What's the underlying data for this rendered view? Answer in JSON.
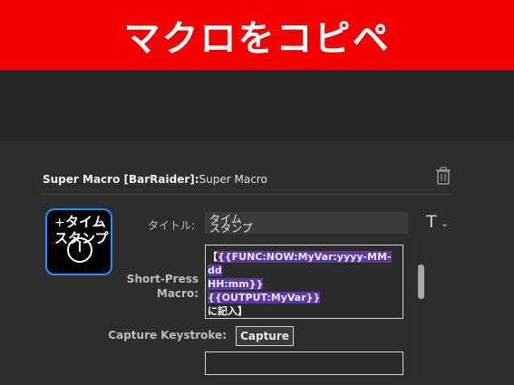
{
  "banner": {
    "text": "マクロをコピペ"
  },
  "header": {
    "plugin_name": "Super Macro [BarRaider]:",
    "plugin_sub": "Super Macro"
  },
  "key_tile": {
    "line1": "タイム",
    "line2": "スタンプ",
    "plus": "+",
    "chevron": "⌄"
  },
  "fields": {
    "title_label": "タイトル:",
    "title_value": "タイム\nスタンプ",
    "title_font_icon": "T",
    "title_font_chevron": "⌄",
    "short_press_label": "Short-Press\nMacro:",
    "macro_lines": {
      "line1_prefix": "【",
      "line1_hl": "{{FUNC:NOW:MyVar:yyyy-MM-dd",
      "line2_hl": "HH:mm}}",
      "line3_hl": "{{OUTPUT:MyVar}}",
      "line4": "に記入】"
    },
    "capture_label": "Capture Keystroke:",
    "capture_button": "Capture"
  },
  "icons": {
    "trash": "trash-icon",
    "clock": "clock-icon"
  },
  "colors": {
    "banner": "#f40000",
    "accent": "#1e90ff",
    "highlight": "#5a3aa0"
  }
}
